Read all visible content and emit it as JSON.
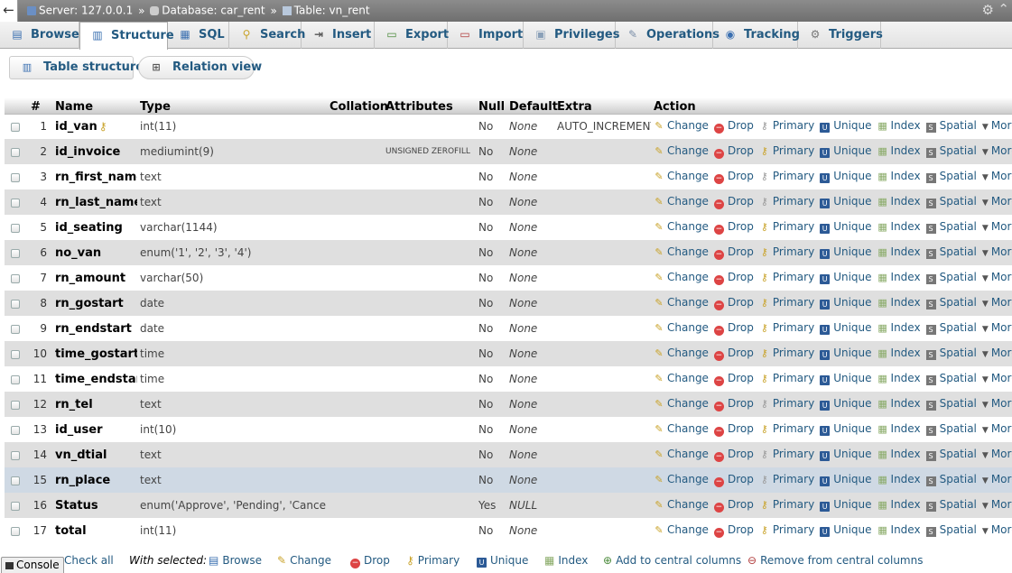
{
  "topbar": {
    "server_label": "Server: 127.0.0.1",
    "database_label": "Database: car_rent",
    "table_label": "Table: vn_rent",
    "separator": "»"
  },
  "tabs": [
    {
      "label": "Browse",
      "icon": "browse-icon"
    },
    {
      "label": "Structure",
      "icon": "structure-icon",
      "active": true
    },
    {
      "label": "SQL",
      "icon": "sql-icon"
    },
    {
      "label": "Search",
      "icon": "search-icon"
    },
    {
      "label": "Insert",
      "icon": "insert-icon"
    },
    {
      "label": "Export",
      "icon": "export-icon"
    },
    {
      "label": "Import",
      "icon": "import-icon"
    },
    {
      "label": "Privileges",
      "icon": "privileges-icon"
    },
    {
      "label": "Operations",
      "icon": "operations-icon"
    },
    {
      "label": "Tracking",
      "icon": "tracking-icon"
    },
    {
      "label": "Triggers",
      "icon": "triggers-icon"
    }
  ],
  "subtabs": [
    {
      "label": "Table structure",
      "icon": "table-structure-icon"
    },
    {
      "label": "Relation view",
      "icon": "relation-view-icon"
    }
  ],
  "columns": [
    "#",
    "Name",
    "Type",
    "Collation",
    "Attributes",
    "Null",
    "Default",
    "Extra",
    "Action"
  ],
  "actions": {
    "change": "Change",
    "drop": "Drop",
    "primary": "Primary",
    "unique": "Unique",
    "index": "Index",
    "spatial": "Spatial",
    "more": "More"
  },
  "rows": [
    {
      "num": "1",
      "name": "id_van",
      "type": "int(11)",
      "collation": "",
      "attributes": "",
      "null": "No",
      "default": "None",
      "extra": "AUTO_INCREMENT",
      "primary_key": true
    },
    {
      "num": "2",
      "name": "id_invoice",
      "type": "mediumint(9)",
      "collation": "",
      "attributes": "UNSIGNED ZEROFILL",
      "null": "No",
      "default": "None",
      "extra": ""
    },
    {
      "num": "3",
      "name": "rn_first_name",
      "type": "text",
      "collation": "",
      "attributes": "",
      "null": "No",
      "default": "None",
      "extra": ""
    },
    {
      "num": "4",
      "name": "rn_last_name",
      "type": "text",
      "collation": "",
      "attributes": "",
      "null": "No",
      "default": "None",
      "extra": ""
    },
    {
      "num": "5",
      "name": "id_seating",
      "type": "varchar(1144)",
      "collation": "",
      "attributes": "",
      "null": "No",
      "default": "None",
      "extra": ""
    },
    {
      "num": "6",
      "name": "no_van",
      "type": "enum('1', '2', '3', '4')",
      "collation": "",
      "attributes": "",
      "null": "No",
      "default": "None",
      "extra": ""
    },
    {
      "num": "7",
      "name": "rn_amount",
      "type": "varchar(50)",
      "collation": "",
      "attributes": "",
      "null": "No",
      "default": "None",
      "extra": ""
    },
    {
      "num": "8",
      "name": "rn_gostart",
      "type": "date",
      "collation": "",
      "attributes": "",
      "null": "No",
      "default": "None",
      "extra": ""
    },
    {
      "num": "9",
      "name": "rn_endstart",
      "type": "date",
      "collation": "",
      "attributes": "",
      "null": "No",
      "default": "None",
      "extra": ""
    },
    {
      "num": "10",
      "name": "time_gostart",
      "type": "time",
      "collation": "",
      "attributes": "",
      "null": "No",
      "default": "None",
      "extra": ""
    },
    {
      "num": "11",
      "name": "time_endstart",
      "type": "time",
      "collation": "",
      "attributes": "",
      "null": "No",
      "default": "None",
      "extra": ""
    },
    {
      "num": "12",
      "name": "rn_tel",
      "type": "text",
      "collation": "",
      "attributes": "",
      "null": "No",
      "default": "None",
      "extra": ""
    },
    {
      "num": "13",
      "name": "id_user",
      "type": "int(10)",
      "collation": "",
      "attributes": "",
      "null": "No",
      "default": "None",
      "extra": ""
    },
    {
      "num": "14",
      "name": "vn_dtial",
      "type": "text",
      "collation": "",
      "attributes": "",
      "null": "No",
      "default": "None",
      "extra": ""
    },
    {
      "num": "15",
      "name": "rn_place",
      "type": "text",
      "collation": "",
      "attributes": "",
      "null": "No",
      "default": "None",
      "extra": "",
      "highlighted": true
    },
    {
      "num": "16",
      "name": "Status",
      "type": "enum('Approve', 'Pending', 'Canceled')",
      "collation": "",
      "attributes": "",
      "null": "Yes",
      "default": "NULL",
      "extra": ""
    },
    {
      "num": "17",
      "name": "total",
      "type": "int(11)",
      "collation": "",
      "attributes": "",
      "null": "No",
      "default": "None",
      "extra": ""
    }
  ],
  "footer": {
    "console": "Console",
    "check_all": "Check all",
    "with_selected": "With selected:",
    "browse": "Browse",
    "change": "Change",
    "drop": "Drop",
    "primary": "Primary",
    "unique": "Unique",
    "index": "Index",
    "add_central": "Add to central columns",
    "remove_central": "Remove from central columns"
  },
  "colors": {
    "link": "#235a81",
    "row_even": "#dfdfdf",
    "row_highlight": "#cfd9e4",
    "topbar": "#7a7a7a"
  }
}
